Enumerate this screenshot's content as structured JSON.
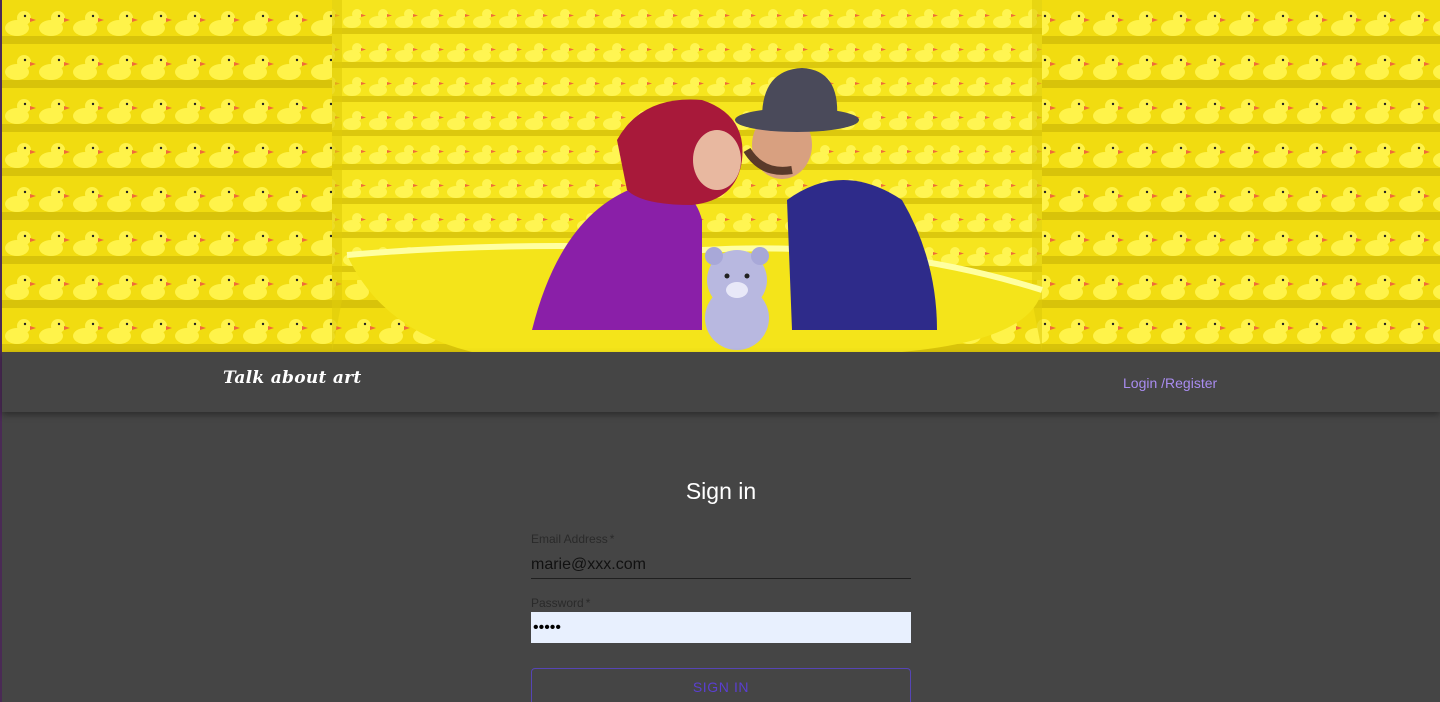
{
  "navbar": {
    "brand": "Talk about art",
    "login_link": "Login /Register"
  },
  "form": {
    "title": "Sign in",
    "email_label": "Email Address",
    "email_value": "marie@xxx.com",
    "password_label": "Password",
    "password_value": "•••••",
    "required_marker": "*",
    "submit_label": "SIGN IN"
  },
  "colors": {
    "background": "#454545",
    "link": "#a98cf0",
    "button_text": "#5a3fd0",
    "autofill": "#e8f0fe",
    "banner_yellow": "#f4e21c"
  }
}
